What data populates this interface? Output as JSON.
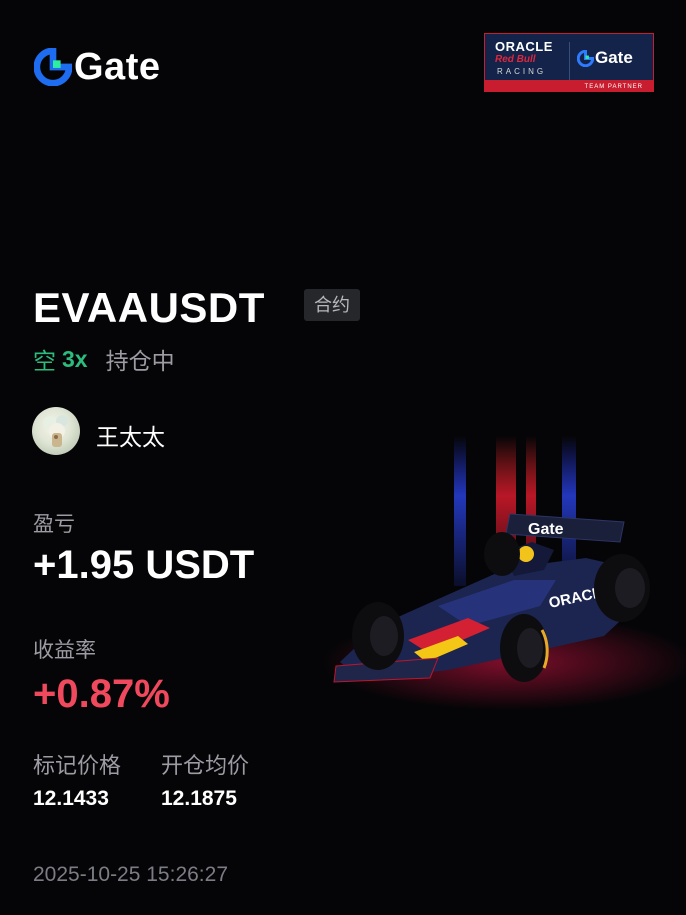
{
  "brand": {
    "logo_text": "Gate",
    "logo_icon": "gate-logo-icon",
    "accent_color": "#1e6cf0",
    "accent_green": "#2cf0a0"
  },
  "partner_badge": {
    "oracle": "ORACLE",
    "red_bull": "Red Bull",
    "racing": "RACING",
    "gate": "Gate",
    "team_partner": "TEAM PARTNER"
  },
  "position": {
    "pair": "EVAAUSDT",
    "contract_type": "合约",
    "direction": "空",
    "leverage": "3x",
    "status": "持仓中"
  },
  "user": {
    "name": "王太太",
    "avatar_icon": "avatar"
  },
  "pnl": {
    "label": "盈亏",
    "value": "+1.95 USDT"
  },
  "roi": {
    "label": "收益率",
    "value": "+0.87%"
  },
  "prices": {
    "mark_label": "标记价格",
    "mark_value": "12.1433",
    "entry_label": "开仓均价",
    "entry_value": "12.1875"
  },
  "timestamp": "2025-10-25 15:26:27",
  "car_branding": {
    "wing_text": "Gate",
    "sidepod_text": "ORACLE"
  },
  "colors": {
    "background": "#050507",
    "positive_green": "#2cbc7e",
    "roi_red": "#f0495e",
    "muted_text": "#9c9ca3"
  }
}
